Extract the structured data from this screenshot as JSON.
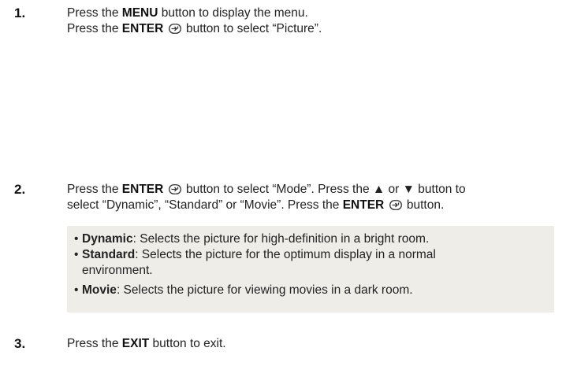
{
  "steps": [
    {
      "number": "1.",
      "lines": [
        {
          "pre": "Press the ",
          "key": "MENU",
          "post": " button to display the menu."
        },
        {
          "pre": "Press the ",
          "key": "ENTER",
          "post": " button to select “Picture”."
        }
      ]
    },
    {
      "number": "2.",
      "line1": {
        "pre": "Press the ",
        "key": "ENTER",
        "mid": " button to select “Mode”. Press the ",
        "up": "▲",
        "or": " or ",
        "down": "▼",
        "post": " button to"
      },
      "line2": {
        "pre": "select “Dynamic”, “Standard” or “Movie”. Press the ",
        "key": "ENTER",
        "post": " button."
      }
    },
    {
      "number": "3.",
      "lines": [
        {
          "pre": "Press the ",
          "key": "EXIT",
          "post": " button to exit."
        }
      ]
    }
  ],
  "modes": [
    {
      "name": "Dynamic",
      "desc": ": Selects the picture for high-definition in a bright room."
    },
    {
      "name": "Standard",
      "desc": ": Selects the picture for the optimum display in a normal",
      "desc2": "environment."
    },
    {
      "name": "Movie",
      "desc": ": Selects the picture for viewing movies in a dark room."
    }
  ],
  "bullet": "•",
  "icons": {
    "enter": "enter-icon"
  }
}
